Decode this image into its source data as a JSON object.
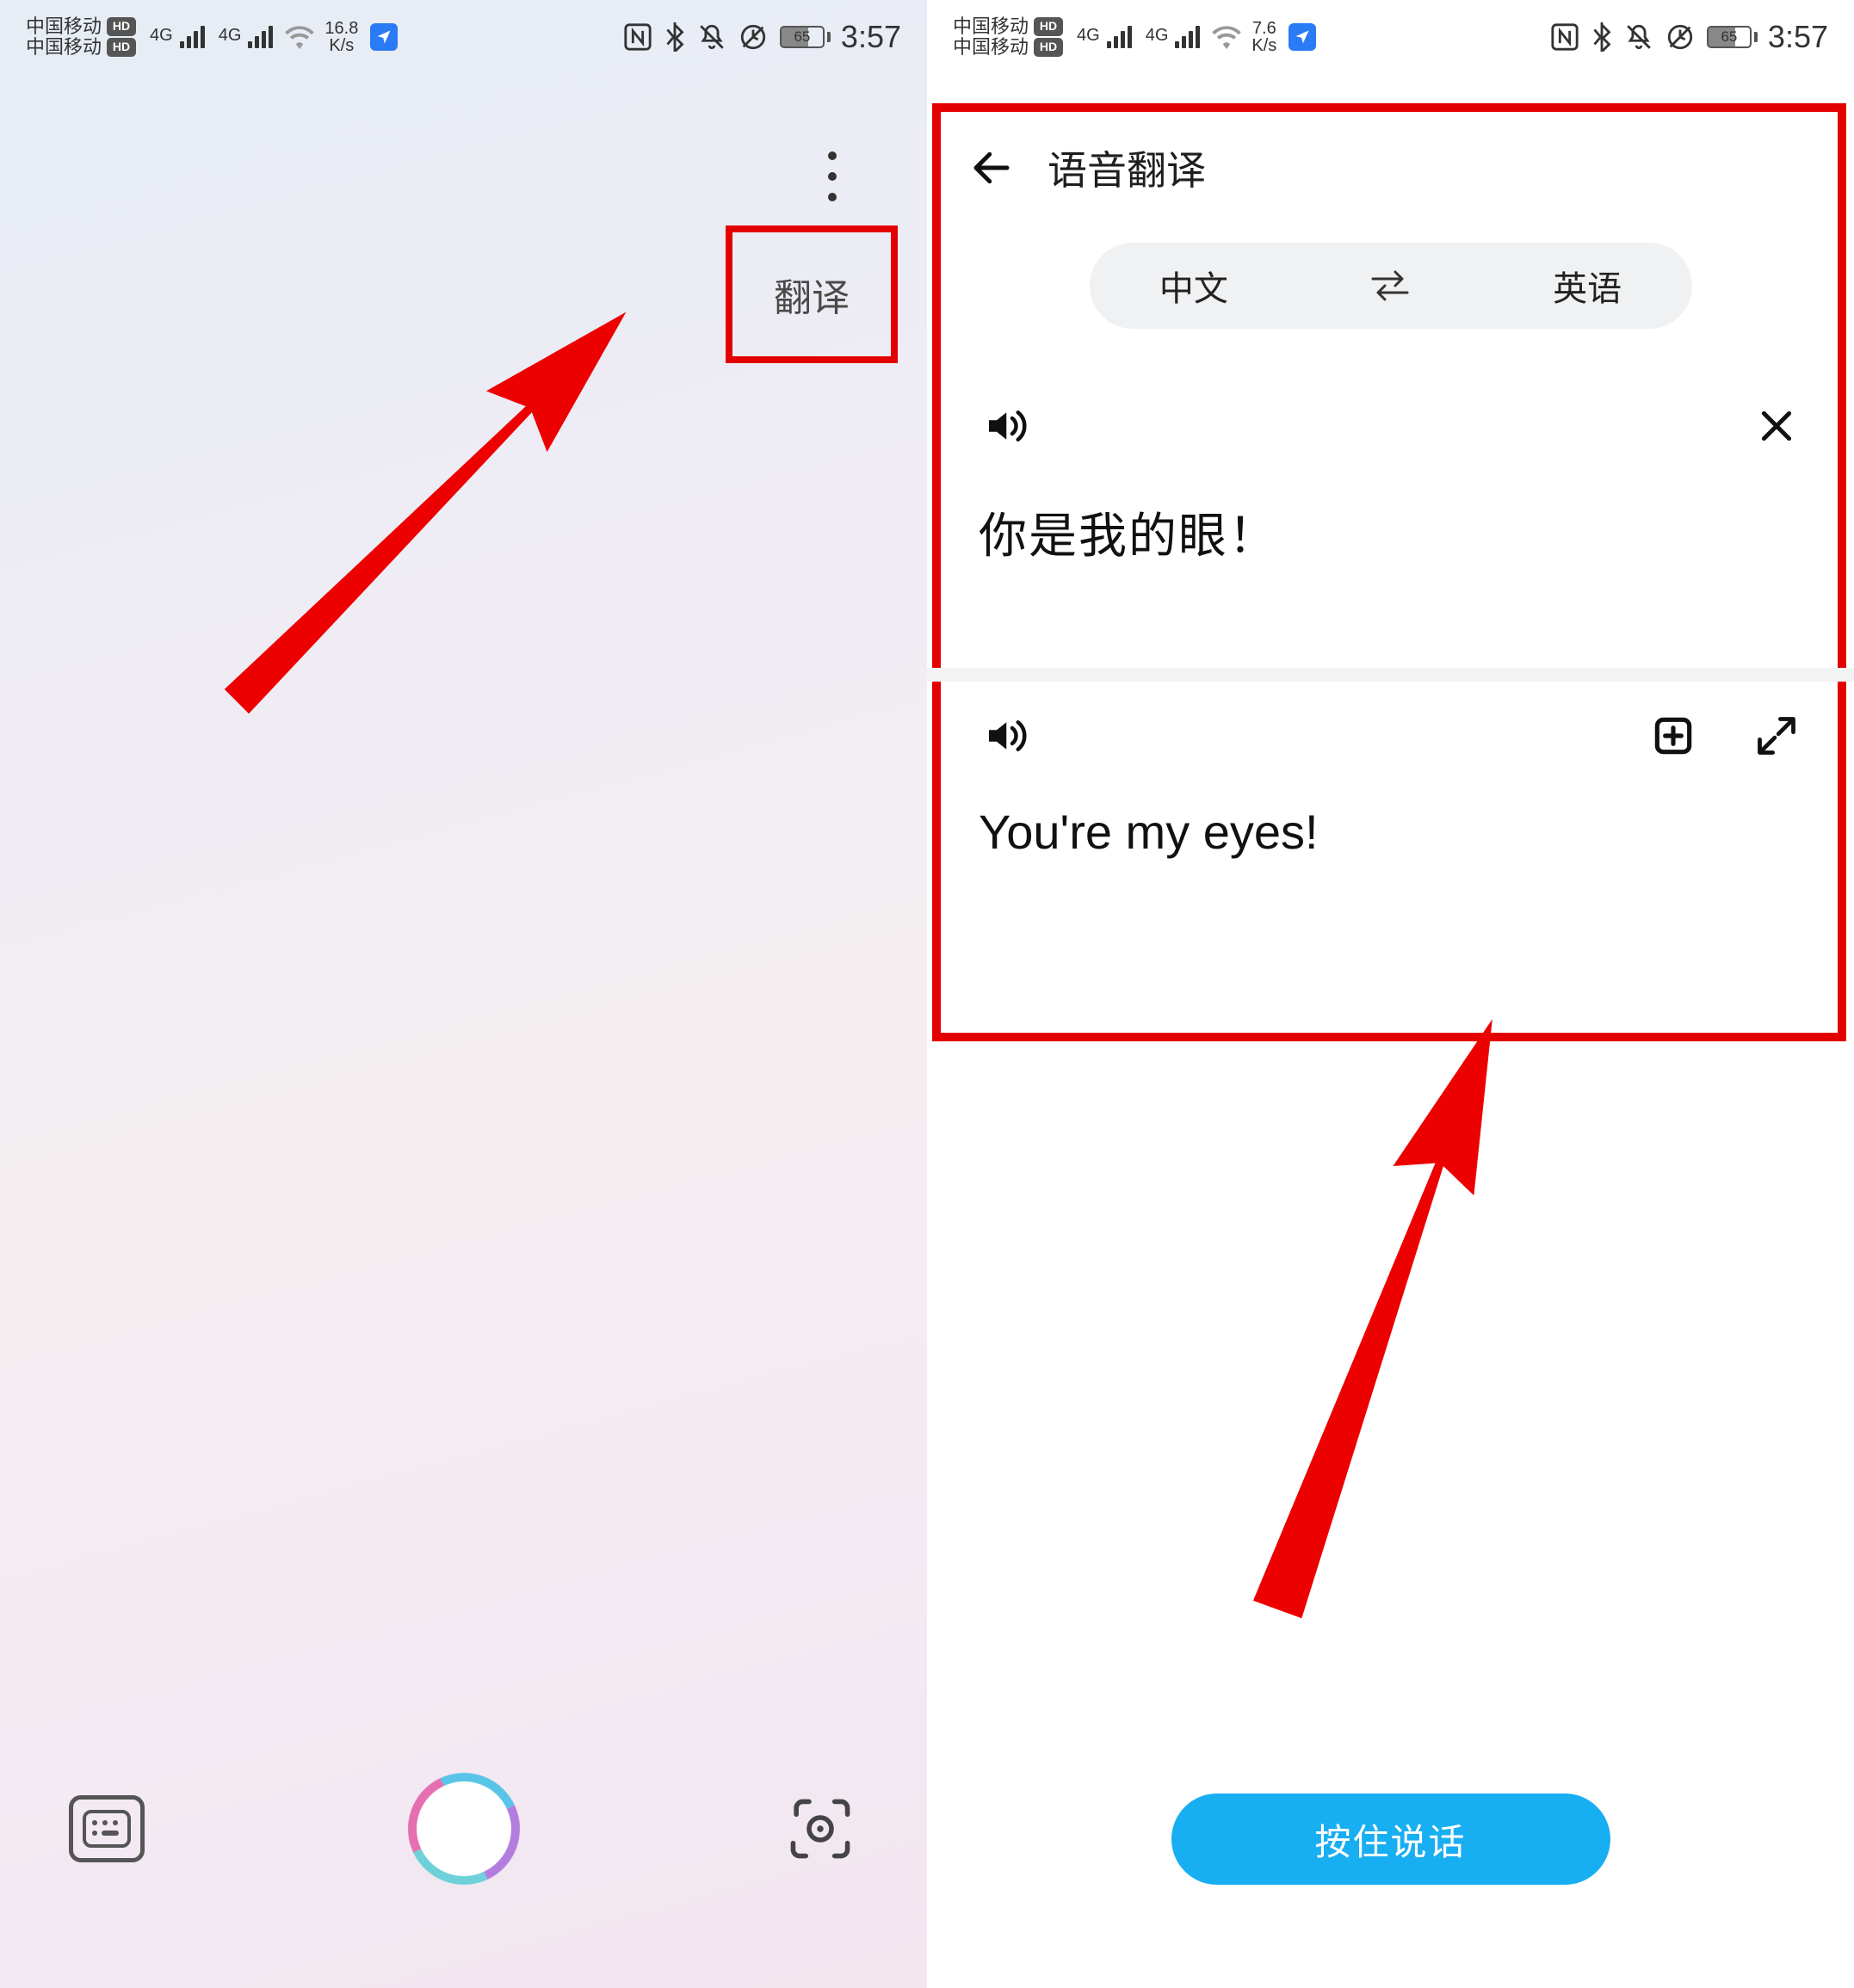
{
  "left": {
    "status": {
      "carrier": "中国移动",
      "hd": "HD",
      "net_label": "4G",
      "speed_value": "16.8",
      "speed_unit": "K/s",
      "battery": "65",
      "clock": "3:57"
    },
    "translate_label": "翻译"
  },
  "right": {
    "status": {
      "carrier": "中国移动",
      "hd": "HD",
      "net_label": "4G",
      "speed_value": "7.6",
      "speed_unit": "K/s",
      "battery": "65",
      "clock": "3:57"
    },
    "header_title": "语音翻译",
    "lang_source": "中文",
    "lang_target": "英语",
    "source_text": "你是我的眼！",
    "target_text": "You're my eyes!",
    "talk_button": "按住说话"
  }
}
